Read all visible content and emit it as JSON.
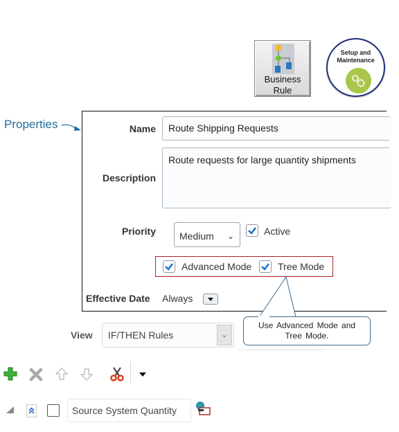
{
  "top_icons": {
    "business_rule": {
      "line1": "Business",
      "line2": "Rule"
    },
    "setup_maintenance": {
      "line1": "Setup and",
      "line2": "Maintenance"
    }
  },
  "annotation": {
    "properties_label": "Properties",
    "callout_line1": "Use Advanced Mode and",
    "callout_line2": "Tree Mode."
  },
  "form": {
    "name_label": "Name",
    "name_value": "Route Shipping Requests",
    "description_label": "Description",
    "description_value": "Route requests for large quantity shipments",
    "priority_label": "Priority",
    "priority_value": "Medium",
    "active_label": "Active",
    "active_checked": true,
    "advanced_mode_label": "Advanced Mode",
    "advanced_mode_checked": true,
    "tree_mode_label": "Tree Mode",
    "tree_mode_checked": true,
    "effective_date_label": "Effective Date",
    "effective_date_value": "Always"
  },
  "view": {
    "label": "View",
    "value": "IF/THEN Rules"
  },
  "toolbar": {
    "items": [
      "add-icon",
      "delete-icon",
      "move-up-icon",
      "move-down-icon",
      "cut-icon",
      "more-dropdown-icon"
    ]
  },
  "tree_row": {
    "value": "Source System Quantity"
  },
  "colors": {
    "accent_blue": "#1f6e9c",
    "highlight_red": "#b01e2a",
    "check_blue": "#1a73c8"
  }
}
